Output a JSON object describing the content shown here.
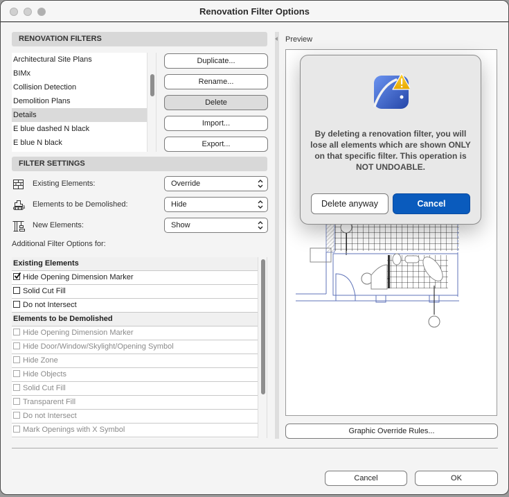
{
  "window": {
    "title": "Renovation Filter Options"
  },
  "renovation_filters": {
    "header": "RENOVATION FILTERS",
    "items": [
      {
        "label": "Architectural Site Plans",
        "selected": false
      },
      {
        "label": "BIMx",
        "selected": false
      },
      {
        "label": "Collision Detection",
        "selected": false
      },
      {
        "label": "Demolition Plans",
        "selected": false
      },
      {
        "label": "Details",
        "selected": true
      },
      {
        "label": "E blue dashed N black",
        "selected": false
      },
      {
        "label": "E blue N black",
        "selected": false
      }
    ],
    "buttons": {
      "duplicate": "Duplicate...",
      "rename": "Rename...",
      "delete": "Delete",
      "import": "Import...",
      "export": "Export..."
    }
  },
  "filter_settings": {
    "header": "FILTER SETTINGS",
    "rows": [
      {
        "icon": "brick-wall-icon",
        "label": "Existing Elements:",
        "value": "Override"
      },
      {
        "icon": "bulldozer-icon",
        "label": "Elements to be Demolished:",
        "value": "Hide"
      },
      {
        "icon": "crane-icon",
        "label": "New Elements:",
        "value": "Show"
      }
    ],
    "additional_label": "Additional Filter Options for:"
  },
  "options": [
    {
      "type": "group",
      "label": "Existing Elements"
    },
    {
      "type": "option",
      "label": "Hide Opening Dimension Marker",
      "checked": true,
      "disabled": false
    },
    {
      "type": "option",
      "label": "Solid Cut Fill",
      "checked": false,
      "disabled": false
    },
    {
      "type": "option",
      "label": "Do not Intersect",
      "checked": false,
      "disabled": false
    },
    {
      "type": "group",
      "label": "Elements to be Demolished"
    },
    {
      "type": "option",
      "label": "Hide Opening Dimension Marker",
      "checked": false,
      "disabled": true
    },
    {
      "type": "option",
      "label": "Hide Door/Window/Skylight/Opening Symbol",
      "checked": false,
      "disabled": true
    },
    {
      "type": "option",
      "label": "Hide Zone",
      "checked": false,
      "disabled": true
    },
    {
      "type": "option",
      "label": "Hide Objects",
      "checked": false,
      "disabled": true
    },
    {
      "type": "option",
      "label": "Solid Cut Fill",
      "checked": false,
      "disabled": true
    },
    {
      "type": "option",
      "label": "Transparent Fill",
      "checked": false,
      "disabled": true
    },
    {
      "type": "option",
      "label": "Do not Intersect",
      "checked": false,
      "disabled": true
    },
    {
      "type": "option",
      "label": "Mark Openings with X Symbol",
      "checked": false,
      "disabled": true
    }
  ],
  "preview": {
    "label": "Preview",
    "graphic_override_button": "Graphic Override Rules..."
  },
  "footer": {
    "cancel": "Cancel",
    "ok": "OK"
  },
  "alert": {
    "icon": "archicad-warning-icon",
    "message": "By deleting a renovation filter, you will lose all elements which are shown ONLY on that specific filter. This operation is NOT UNDOABLE.",
    "delete_anyway": "Delete anyway",
    "cancel": "Cancel",
    "primary_color": "#0a5bbd"
  }
}
